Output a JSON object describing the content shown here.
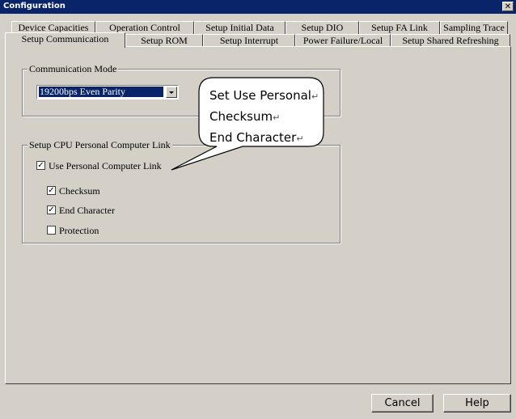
{
  "window": {
    "title": "Configuration",
    "close": "✕"
  },
  "tabs_row1": [
    "Device Capacities",
    "Operation Control",
    "Setup Initial Data",
    "Setup DIO",
    "Setup FA Link",
    "Sampling Trace"
  ],
  "tabs_row2": [
    "Setup Communication",
    "Setup ROM",
    "Setup Interrupt",
    "Power Failure/Local",
    "Setup Shared Refreshing"
  ],
  "communication_mode": {
    "title": "Communication Mode",
    "selected": "19200bps Even Parity"
  },
  "cpu_link": {
    "title": "Setup CPU Personal Computer Link",
    "use_link": {
      "label": "Use Personal Computer Link",
      "checked": true
    },
    "checksum": {
      "label": "Checksum",
      "checked": true
    },
    "end_character": {
      "label": "End Character",
      "checked": true
    },
    "protection": {
      "label": "Protection",
      "checked": false
    }
  },
  "callout": {
    "line1": "Set Use Personal",
    "line2": "Checksum",
    "line3": "End Character",
    "mark": "↵"
  },
  "buttons": {
    "cancel": "Cancel",
    "help": "Help"
  }
}
